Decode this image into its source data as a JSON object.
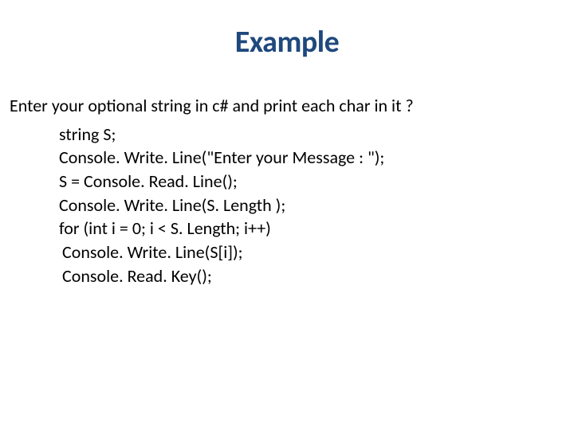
{
  "title": "Example",
  "prompt": "Enter your optional string in c# and  print each char in it  ?",
  "code": {
    "line1": "string S;",
    "line2": "Console. Write. Line(\"Enter your Message : \");",
    "line3": "S = Console. Read. Line();",
    "line4": "Console. Write. Line(S. Length );",
    "line5": "for (int i = 0; i < S. Length; i++)",
    "line6": "Console. Write. Line(S[i]);",
    "line7": "Console. Read. Key();"
  }
}
